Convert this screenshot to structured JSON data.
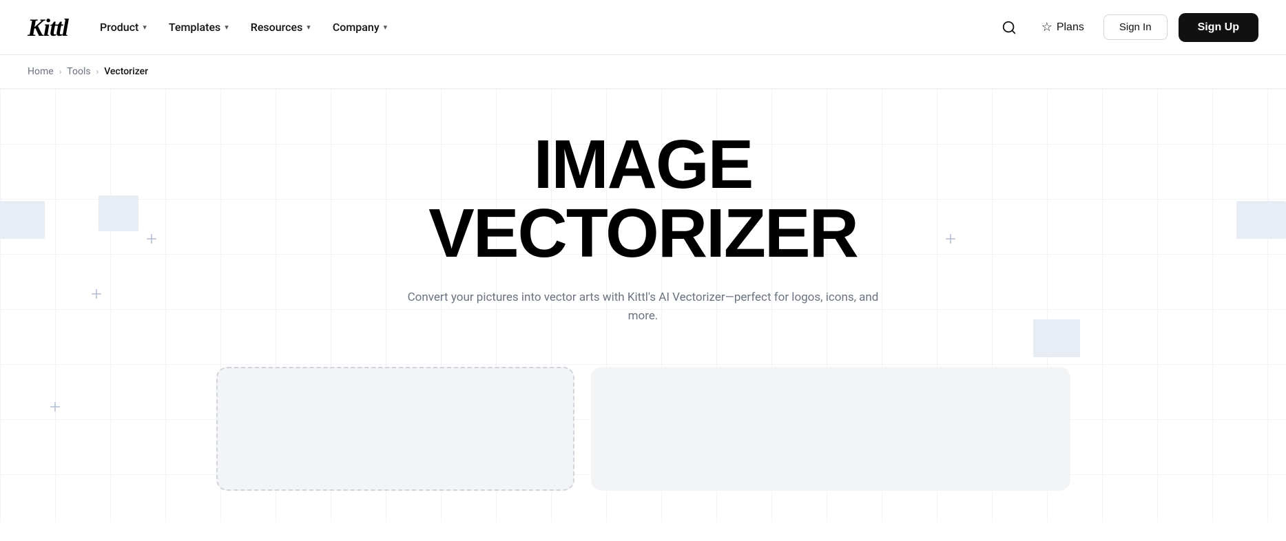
{
  "brand": {
    "logo_text": "Kittl"
  },
  "nav": {
    "items": [
      {
        "label": "Product",
        "has_dropdown": true
      },
      {
        "label": "Templates",
        "has_dropdown": true
      },
      {
        "label": "Resources",
        "has_dropdown": true
      },
      {
        "label": "Company",
        "has_dropdown": true
      }
    ]
  },
  "navbar_right": {
    "plans_label": "Plans",
    "signin_label": "Sign In",
    "signup_label": "Sign Up"
  },
  "breadcrumb": {
    "home": "Home",
    "tools": "Tools",
    "current": "Vectorizer"
  },
  "hero": {
    "title": "IMAGE VECTORIZER",
    "subtitle": "Convert your pictures into vector arts with Kittl's AI Vectorizer—perfect for logos, icons, and more."
  },
  "colors": {
    "accent": "#000000",
    "background": "#ffffff",
    "muted": "#6b7280",
    "card_bg": "#f3f4f6",
    "deco": "#e8edf4"
  }
}
